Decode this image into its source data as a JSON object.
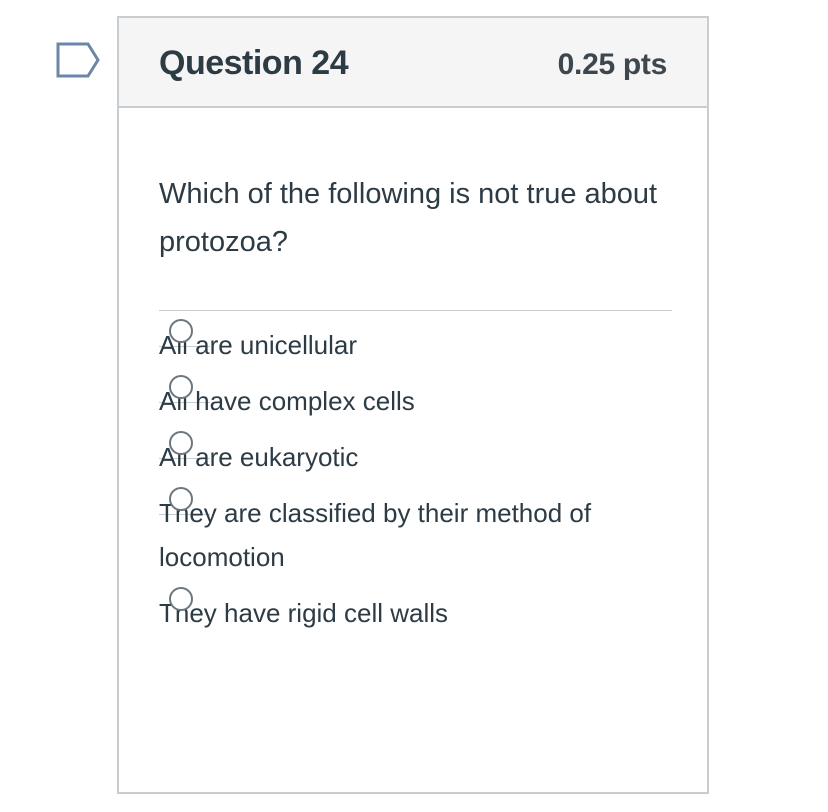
{
  "question": {
    "title": "Question 24",
    "points": "0.25 pts",
    "text": "Which of the following is not true about protozoa?",
    "flag_icon": "bookmark-flag-icon",
    "answers": [
      {
        "label": "All are unicellular"
      },
      {
        "label": "All have complex cells"
      },
      {
        "label": "All are eukaryotic"
      },
      {
        "label": "They are classified by their method of locomotion"
      },
      {
        "label": "They have rigid cell walls"
      }
    ]
  },
  "colors": {
    "border": "#c7cdd1",
    "header_bg": "#f5f5f5",
    "text": "#2d3b45",
    "flag": "#6b87a8"
  }
}
